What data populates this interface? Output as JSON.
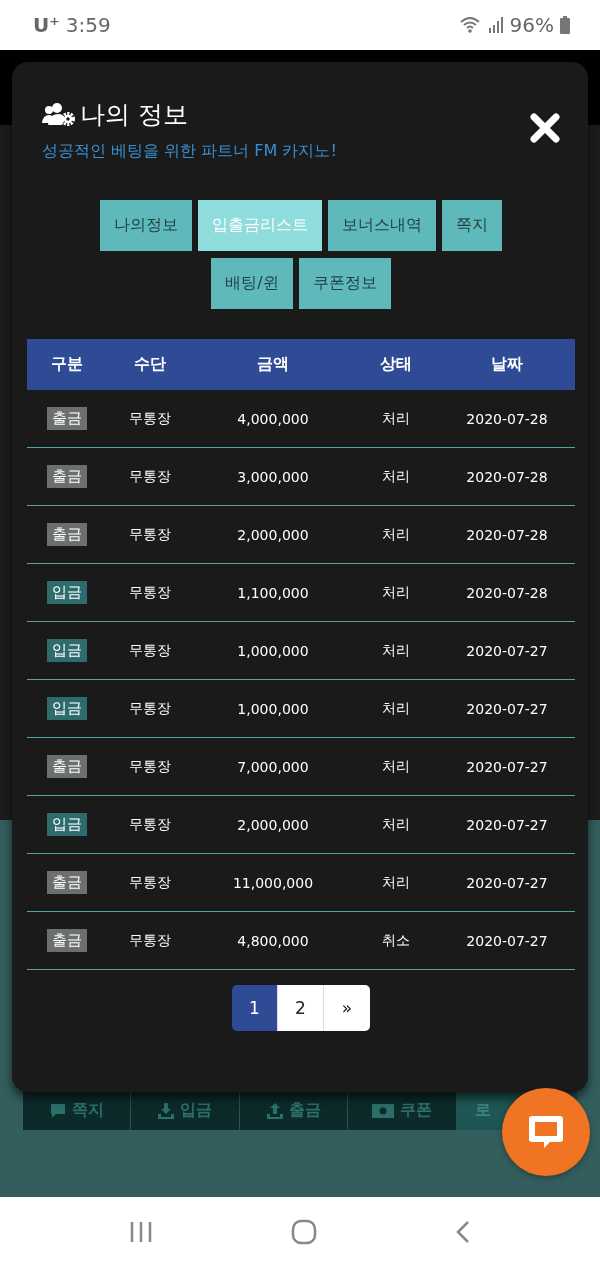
{
  "status_bar": {
    "carrier": "U⁺",
    "time": "3:59",
    "battery": "96%"
  },
  "modal": {
    "title": "나의 정보",
    "subtitle": "성공적인 베팅을 위한 파트너 FM 카지노!",
    "tabs": [
      {
        "label": "나의정보",
        "selected": false
      },
      {
        "label": "입출금리스트",
        "selected": true
      },
      {
        "label": "보너스내역",
        "selected": false
      },
      {
        "label": "쪽지",
        "selected": false
      },
      {
        "label": "배팅/윈",
        "selected": false
      },
      {
        "label": "쿠폰정보",
        "selected": false
      }
    ],
    "table": {
      "columns": [
        "구분",
        "수단",
        "금액",
        "상태",
        "날짜"
      ],
      "rows": [
        {
          "kind": "withdraw",
          "type": "출금",
          "method": "무통장",
          "amount": "4,000,000",
          "status": "처리",
          "date": "2020-07-28"
        },
        {
          "kind": "withdraw",
          "type": "출금",
          "method": "무통장",
          "amount": "3,000,000",
          "status": "처리",
          "date": "2020-07-28"
        },
        {
          "kind": "withdraw",
          "type": "출금",
          "method": "무통장",
          "amount": "2,000,000",
          "status": "처리",
          "date": "2020-07-28"
        },
        {
          "kind": "deposit",
          "type": "입금",
          "method": "무통장",
          "amount": "1,100,000",
          "status": "처리",
          "date": "2020-07-28"
        },
        {
          "kind": "deposit",
          "type": "입금",
          "method": "무통장",
          "amount": "1,000,000",
          "status": "처리",
          "date": "2020-07-27"
        },
        {
          "kind": "deposit",
          "type": "입금",
          "method": "무통장",
          "amount": "1,000,000",
          "status": "처리",
          "date": "2020-07-27"
        },
        {
          "kind": "withdraw",
          "type": "출금",
          "method": "무통장",
          "amount": "7,000,000",
          "status": "처리",
          "date": "2020-07-27"
        },
        {
          "kind": "deposit",
          "type": "입금",
          "method": "무통장",
          "amount": "2,000,000",
          "status": "처리",
          "date": "2020-07-27"
        },
        {
          "kind": "withdraw",
          "type": "출금",
          "method": "무통장",
          "amount": "11,000,000",
          "status": "처리",
          "date": "2020-07-27"
        },
        {
          "kind": "withdraw",
          "type": "출금",
          "method": "무통장",
          "amount": "4,800,000",
          "status": "취소",
          "date": "2020-07-27"
        }
      ]
    },
    "pagination": [
      {
        "label": "1",
        "selected": true
      },
      {
        "label": "2",
        "selected": false
      },
      {
        "label": "»",
        "selected": false
      }
    ]
  },
  "bottom_menu": [
    {
      "kind": "message",
      "label": "쪽지"
    },
    {
      "kind": "deposit",
      "label": "입금"
    },
    {
      "kind": "withdraw",
      "label": "출금"
    },
    {
      "kind": "coupon",
      "label": "쿠폰"
    },
    {
      "kind": "logout",
      "label": "로"
    }
  ]
}
